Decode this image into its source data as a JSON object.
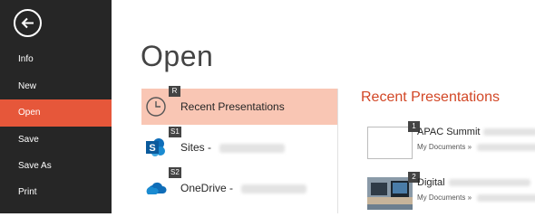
{
  "sidebar": {
    "items": [
      {
        "label": "Info"
      },
      {
        "label": "New"
      },
      {
        "label": "Open"
      },
      {
        "label": "Save"
      },
      {
        "label": "Save As"
      },
      {
        "label": "Print"
      }
    ],
    "active_color": "#e6573a",
    "background": "#262626"
  },
  "page": {
    "title": "Open"
  },
  "places": [
    {
      "key_tip": "R",
      "label": "Recent Presentations",
      "icon": "clock-icon",
      "selected": true
    },
    {
      "key_tip": "S1",
      "label": "Sites - ",
      "icon": "sharepoint-icon",
      "selected": false
    },
    {
      "key_tip": "S2",
      "label": "OneDrive - ",
      "icon": "onedrive-cloud-icon",
      "selected": false
    }
  ],
  "recent": {
    "title": "Recent Presentations",
    "title_color": "#d24726",
    "items": [
      {
        "number": "1",
        "name": "APAC Summit",
        "path": "My Documents » "
      },
      {
        "number": "2",
        "name": "Digital",
        "path": "My Documents » "
      }
    ]
  }
}
